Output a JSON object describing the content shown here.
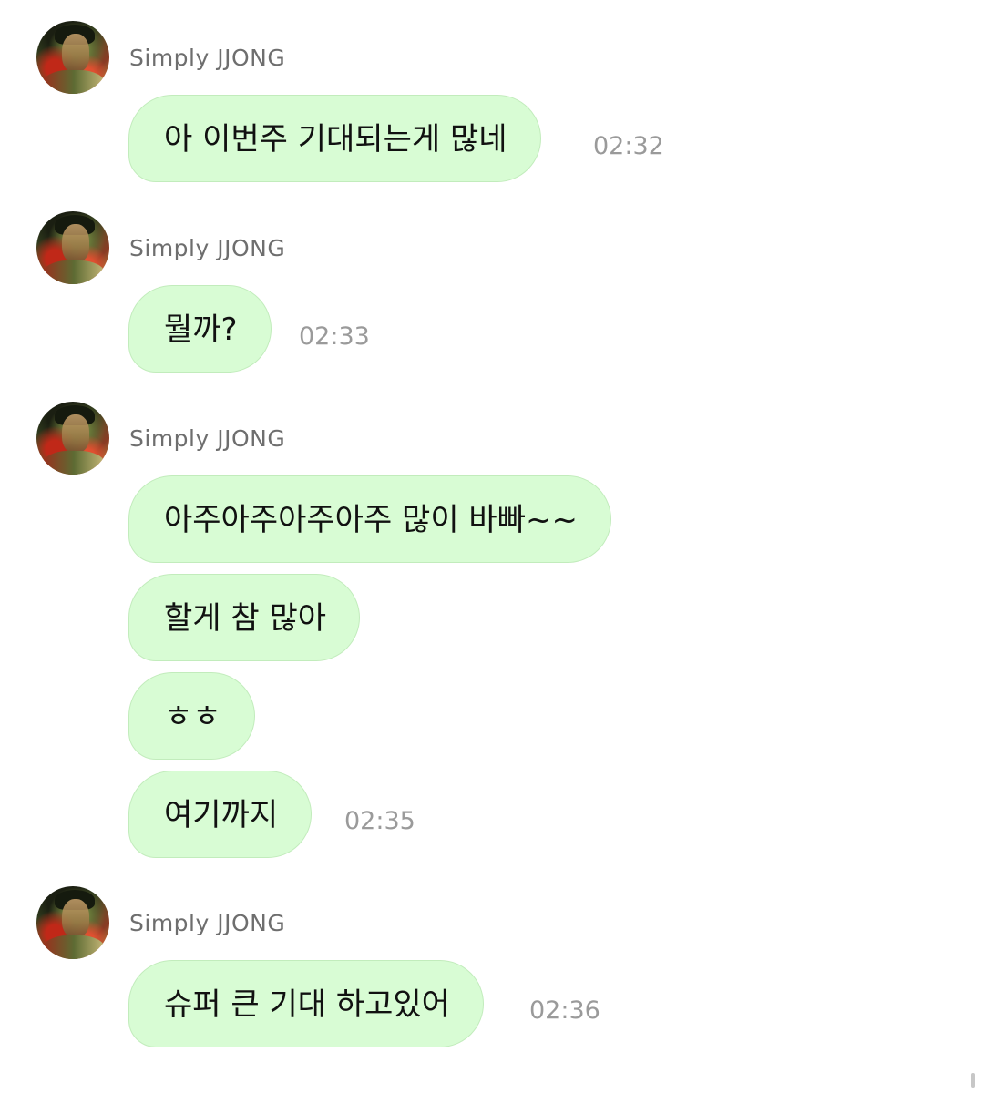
{
  "colors": {
    "bubble_background": "#d8fcd4",
    "bubble_border": "#c2ecbc",
    "sender_name": "#6e6e6e",
    "timestamp": "#9a9a9a",
    "message_text": "#111111"
  },
  "avatar_icon": "profile-photo",
  "groups": [
    {
      "sender": "Simply JJONG",
      "messages": [
        {
          "text": "아 이번주 기대되는게 많네",
          "time": "02:32"
        }
      ]
    },
    {
      "sender": "Simply JJONG",
      "messages": [
        {
          "text": "뭘까?",
          "time": "02:33"
        }
      ]
    },
    {
      "sender": "Simply JJONG",
      "messages": [
        {
          "text": "아주아주아주아주 많이 바빠~~",
          "time": ""
        },
        {
          "text": "할게 참 많아",
          "time": ""
        },
        {
          "text": "ㅎㅎ",
          "time": ""
        },
        {
          "text": "여기까지",
          "time": "02:35"
        }
      ]
    },
    {
      "sender": "Simply JJONG",
      "messages": [
        {
          "text": "슈퍼 큰 기대 하고있어",
          "time": "02:36"
        }
      ]
    }
  ]
}
